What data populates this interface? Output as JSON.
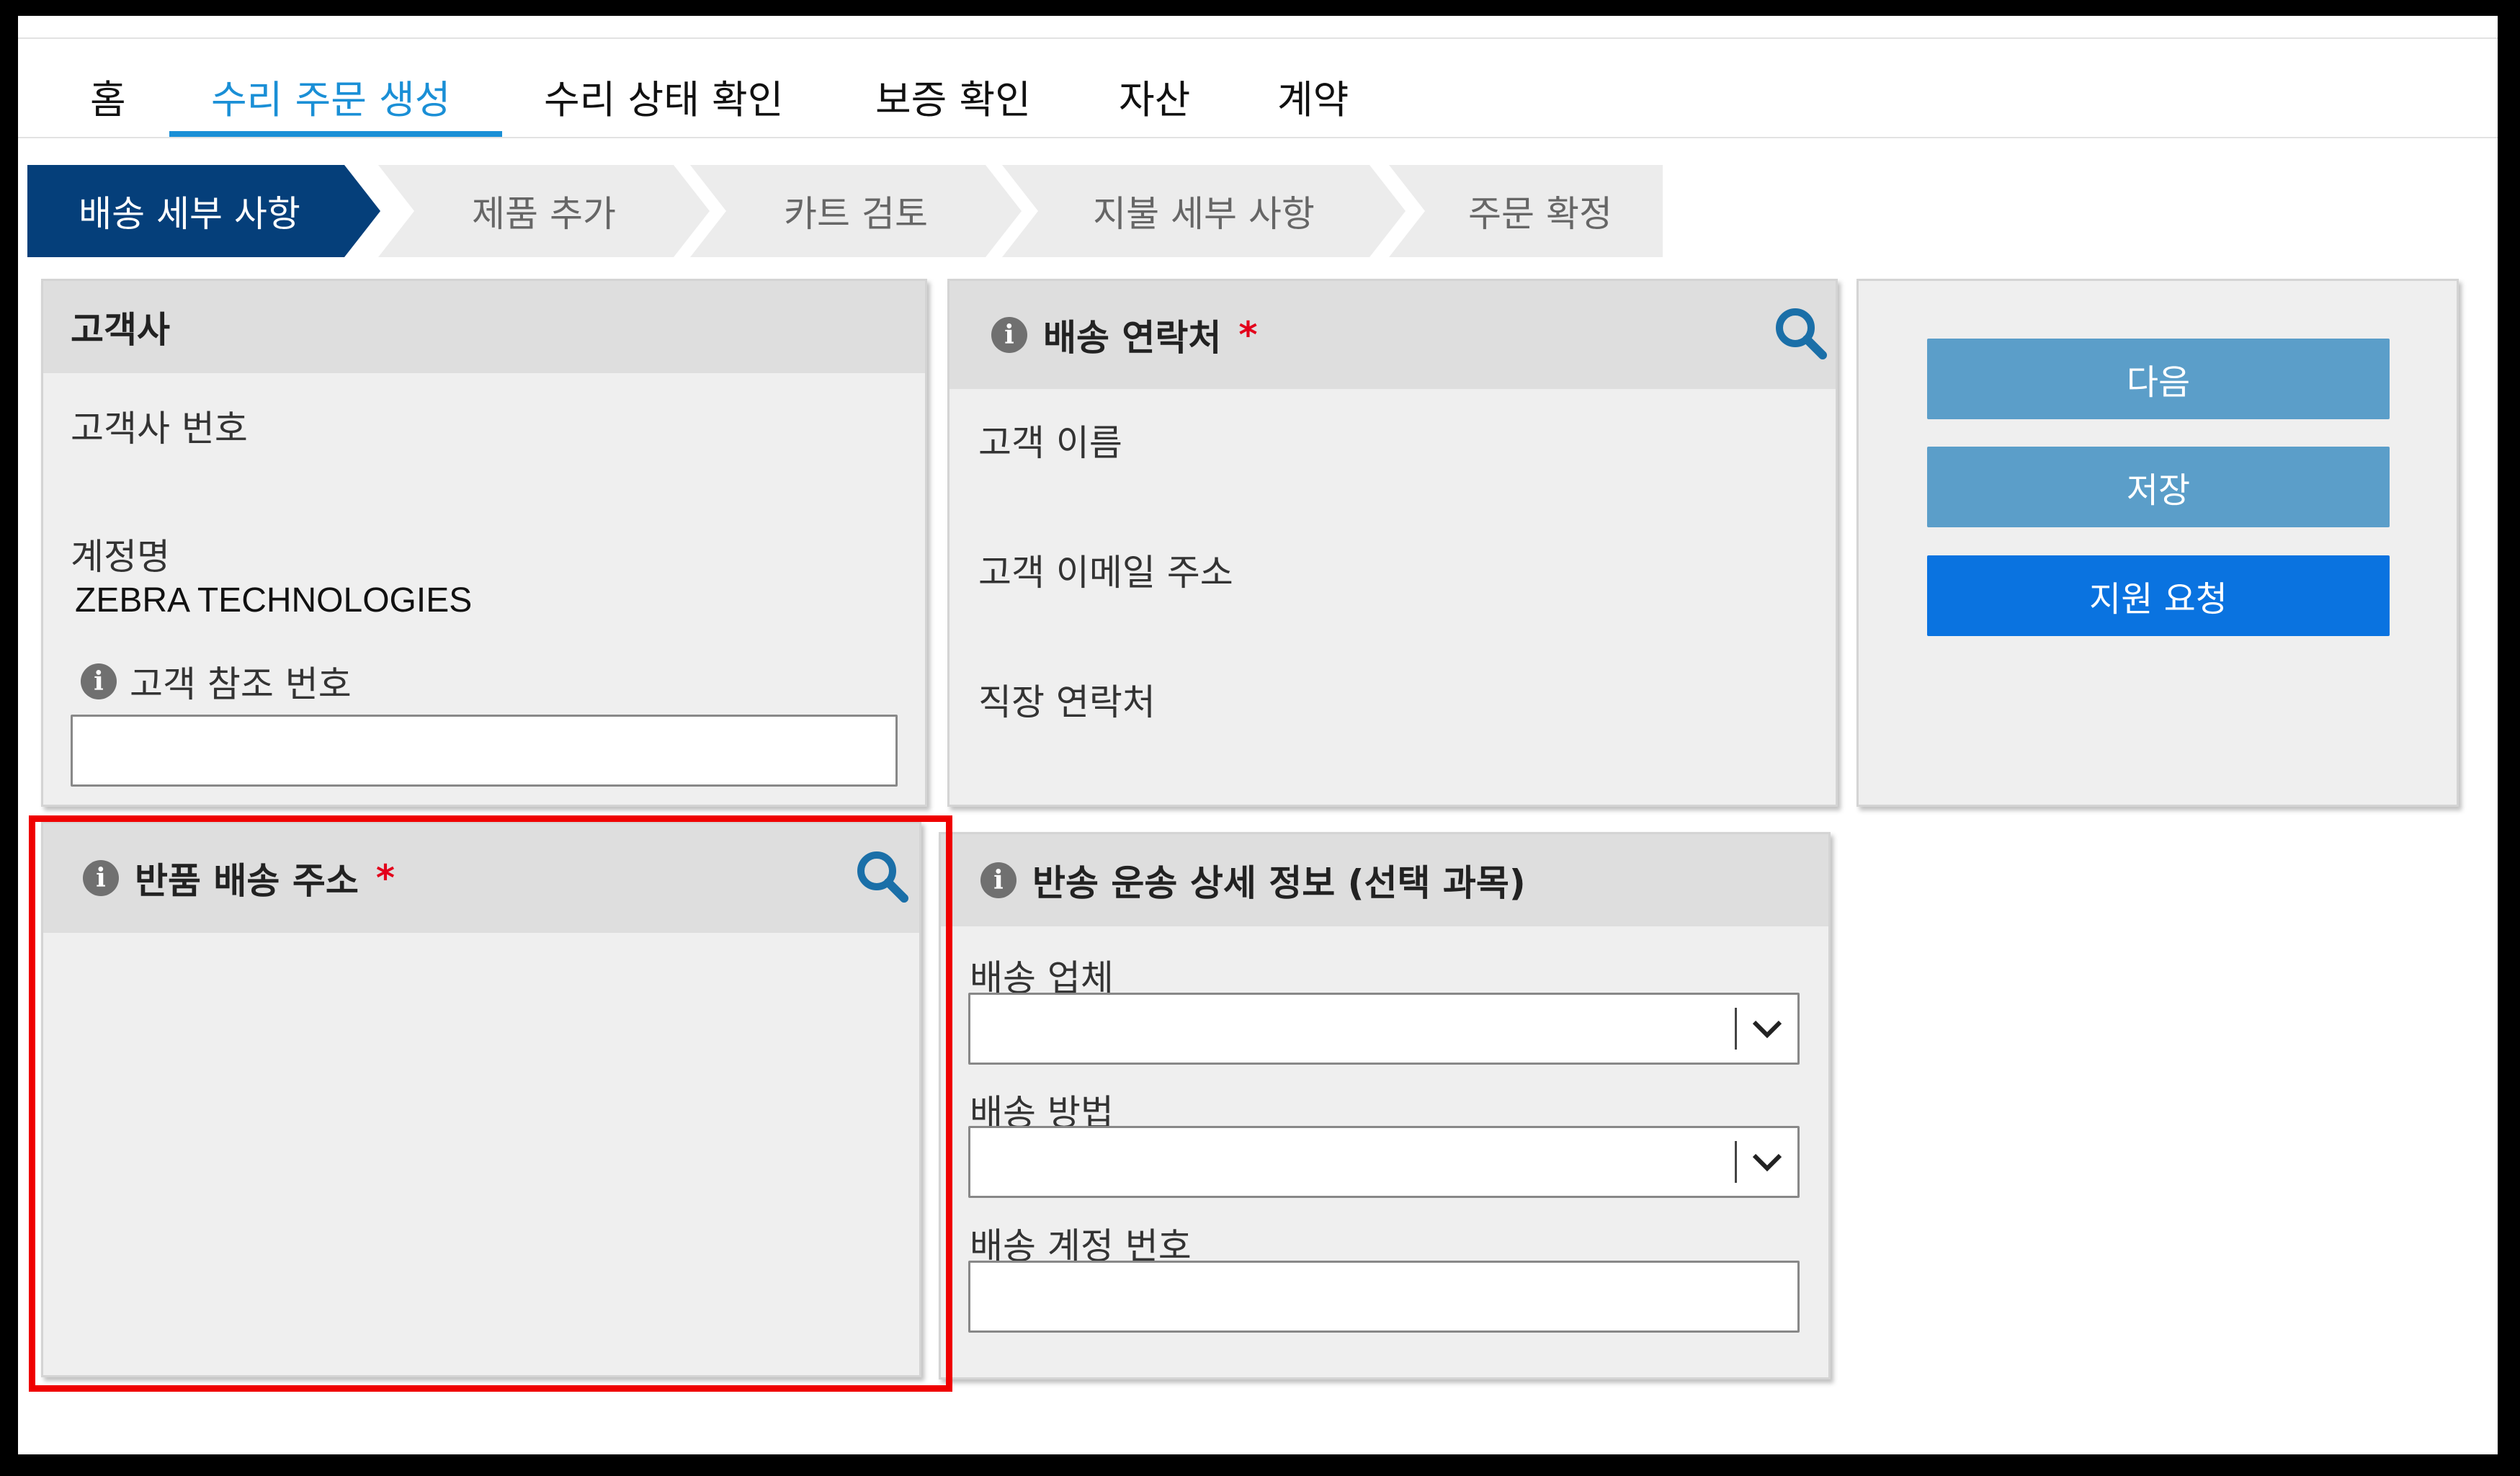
{
  "nav": {
    "items": [
      "홈",
      "수리 주문 생성",
      "수리 상태 확인",
      "보증 확인",
      "자산",
      "계약"
    ],
    "active_index": 1
  },
  "steps": [
    "배송 세부 사항",
    "제품 추가",
    "카트 검토",
    "지불 세부 사항",
    "주문 확정"
  ],
  "customer_panel": {
    "title": "고객사",
    "customer_number_label": "고객사 번호",
    "customer_number_value": "",
    "account_name_label": "계정명",
    "account_name_value": "ZEBRA TECHNOLOGIES",
    "reference_label": "고객 참조 번호",
    "reference_value": ""
  },
  "contact_panel": {
    "title": "배송 연락처",
    "required_mark": "*",
    "name_label": "고객 이름",
    "email_label": "고객 이메일 주소",
    "work_phone_label": "직장 연락처"
  },
  "actions": {
    "next_label": "다음",
    "save_label": "저장",
    "support_label": "지원 요청"
  },
  "return_address_panel": {
    "title": "반품 배송 주소",
    "required_mark": "*"
  },
  "return_shipping_panel": {
    "title": "반송 운송 상세 정보 (선택 과목)",
    "carrier_label": "배송 업체",
    "carrier_value": "",
    "method_label": "배송 방법",
    "method_value": "",
    "account_label": "배송 계정 번호",
    "account_value": ""
  },
  "colors": {
    "nav_active": "#1a8fd6",
    "step_active": "#053f7a",
    "button_disabled": "#5b9ec9",
    "button_primary": "#0a73e0",
    "required": "#e3001b",
    "highlight": "#ef0000",
    "search_icon": "#1a6fa8"
  },
  "icons": [
    "info-icon",
    "search-icon",
    "chevron-down-icon"
  ]
}
